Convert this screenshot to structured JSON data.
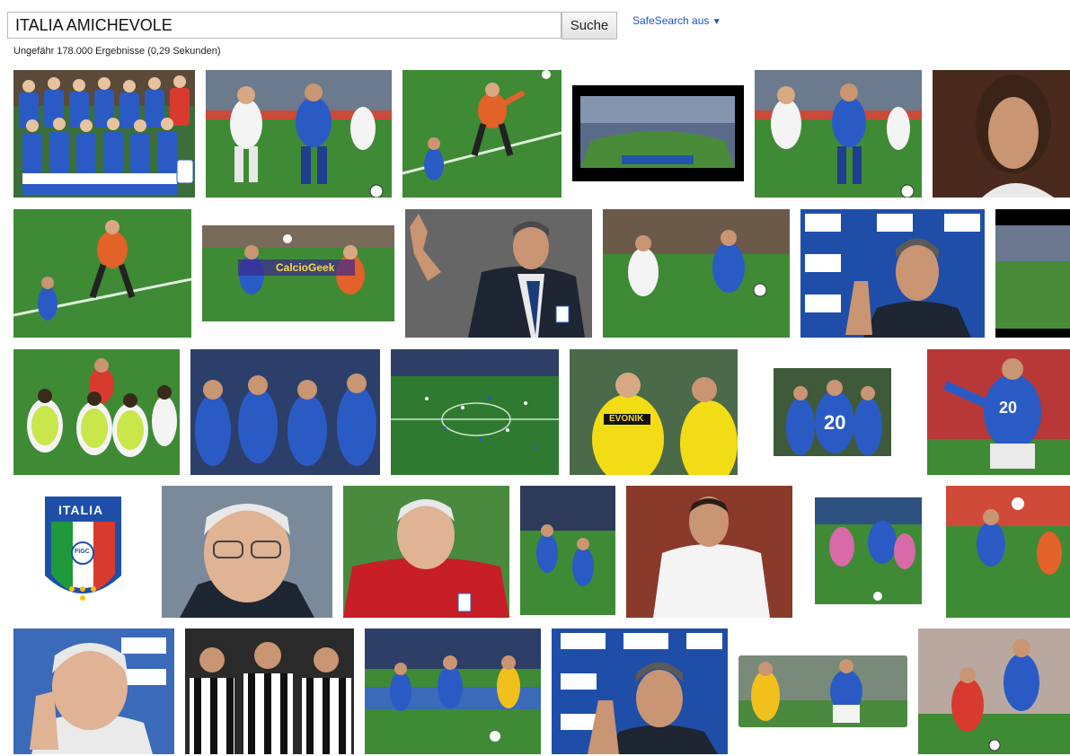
{
  "search": {
    "query": "ITALIA AMICHEVOLE",
    "button_label": "Suche"
  },
  "safesearch": {
    "label": "SafeSearch aus",
    "arrow": "▼"
  },
  "results": {
    "stats": "Ungefähr 178.000 Ergebnisse (0,29 Sekunden)"
  },
  "image_texts": {
    "watermark": "CalcioGeek",
    "crest_word": "ITALIA",
    "crest_badge": "FIGC",
    "sponsor": "EVONIK",
    "shirt_number": "20"
  },
  "colors": {
    "link": "#1a55c9",
    "italy_blue": "#2a5bc5",
    "pitch": "#3f8a35",
    "keeper_orange": "#e2622a",
    "dortmund_yellow": "#f2dc16"
  },
  "thumbnails": [
    {
      "id": "r1-1",
      "kind": "team-photo"
    },
    {
      "id": "r1-2",
      "kind": "match-action"
    },
    {
      "id": "r1-3",
      "kind": "goalkeeper-dive"
    },
    {
      "id": "r1-4",
      "kind": "stadium-screen"
    },
    {
      "id": "r1-5",
      "kind": "match-action"
    },
    {
      "id": "r1-6",
      "kind": "portrait"
    },
    {
      "id": "r2-1",
      "kind": "goalkeeper-dive"
    },
    {
      "id": "r2-2",
      "kind": "match-action-watermark"
    },
    {
      "id": "r2-3",
      "kind": "coach-suit"
    },
    {
      "id": "r2-4",
      "kind": "match-action"
    },
    {
      "id": "r2-5",
      "kind": "press-conference"
    },
    {
      "id": "r2-6",
      "kind": "stadium"
    },
    {
      "id": "r3-1",
      "kind": "referee-bibs"
    },
    {
      "id": "r3-2",
      "kind": "team-huddle"
    },
    {
      "id": "r3-3",
      "kind": "pitch-wide"
    },
    {
      "id": "r3-4",
      "kind": "dortmund-players"
    },
    {
      "id": "r3-5",
      "kind": "celebration"
    },
    {
      "id": "r3-6",
      "kind": "player-20"
    },
    {
      "id": "r4-1",
      "kind": "crest"
    },
    {
      "id": "r4-2",
      "kind": "coach-closeup"
    },
    {
      "id": "r4-3",
      "kind": "coach-red-jacket"
    },
    {
      "id": "r4-4",
      "kind": "match-action"
    },
    {
      "id": "r4-5",
      "kind": "player-white"
    },
    {
      "id": "r4-6",
      "kind": "match-action"
    },
    {
      "id": "r4-7",
      "kind": "match-action"
    },
    {
      "id": "r5-1",
      "kind": "coach-glasses"
    },
    {
      "id": "r5-2",
      "kind": "juventus-players"
    },
    {
      "id": "r5-3",
      "kind": "match-action"
    },
    {
      "id": "r5-4",
      "kind": "press-conference"
    },
    {
      "id": "r5-5",
      "kind": "match-action"
    },
    {
      "id": "r5-6",
      "kind": "match-action"
    }
  ]
}
